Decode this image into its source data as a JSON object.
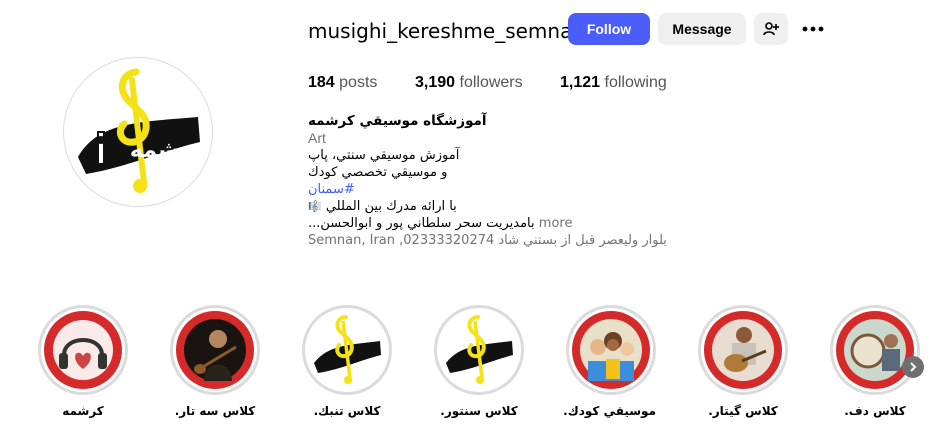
{
  "profile": {
    "username": "musighi_kereshme_semnan",
    "follow_label": "Follow",
    "message_label": "Message",
    "suggest_icon": "person-add-icon",
    "more_icon": "more-horizontal-icon",
    "logo_text": "کرشمه"
  },
  "stats": {
    "posts_count": "184",
    "posts_label": "posts",
    "followers_count": "3,190",
    "followers_label": "followers",
    "following_count": "1,121",
    "following_label": "following"
  },
  "bio": {
    "name": "آموزشگاه موسيقي كرشمه",
    "category": "Art",
    "line1": "آموزش موسيقي سنتي، پاپ",
    "line2": "و موسيقي تخصصي كودك",
    "hashtag": "#سمنان",
    "line3": "با ارائه مدرك بين المللي",
    "line4": "...بامديريت سحر سلطاني پور و ابوالحسن",
    "more_label": "more",
    "address": "Semnan, Iran ,02333320274 بلوار وليعصر قبل از بستني شاد"
  },
  "highlights": [
    {
      "label": "كرشمه",
      "icon": "headphones-heart-icon"
    },
    {
      "label": "كلاس سه تار.",
      "icon": "setar-player-photo"
    },
    {
      "label": "كلاس تنبك.",
      "icon": "kereshme-logo"
    },
    {
      "label": "كلاس سنتور.",
      "icon": "kereshme-logo"
    },
    {
      "label": "موسيقي كودك.",
      "icon": "kids-photo"
    },
    {
      "label": "كلاس گيتار.",
      "icon": "guitar-photo"
    },
    {
      "label": "كلاس دف.",
      "icon": "daf-photo"
    }
  ],
  "colors": {
    "follow_button": "#4a5df9",
    "secondary_button": "#efefef",
    "hashtag": "#3f5efb",
    "highlight_red": "#d42a2a",
    "logo_yellow": "#f5e216"
  }
}
